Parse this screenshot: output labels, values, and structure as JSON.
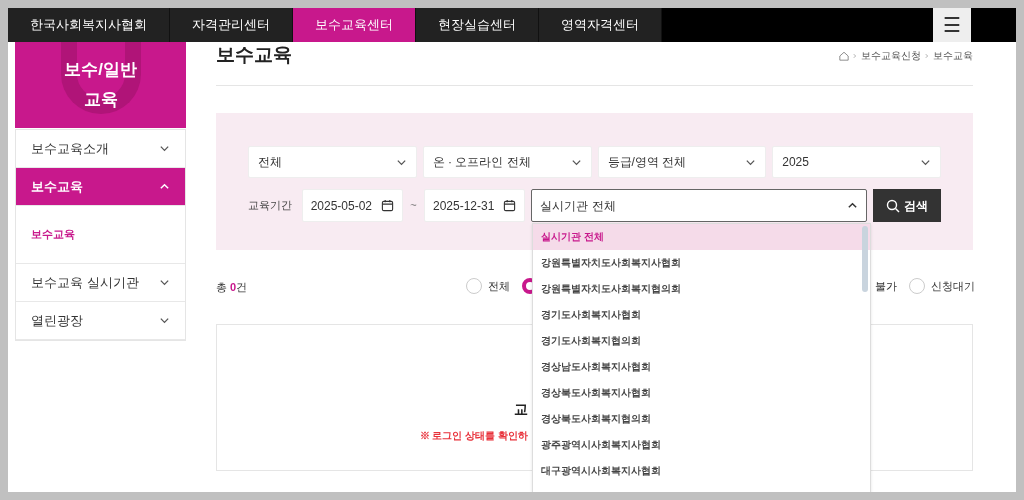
{
  "top_nav": {
    "tabs": [
      {
        "label": "한국사회복지사협회",
        "selected": false
      },
      {
        "label": "자격관리센터",
        "selected": false
      },
      {
        "label": "보수교육센터",
        "selected": true
      },
      {
        "label": "현장실습센터",
        "selected": false
      },
      {
        "label": "영역자격센터",
        "selected": false
      }
    ],
    "menu_button": "☰"
  },
  "sidebar": {
    "title": "보수/일반 교육",
    "items": [
      {
        "label": "보수교육소개",
        "expanded": false
      },
      {
        "label": "보수교육",
        "expanded": true,
        "children": [
          {
            "label": "보수교육",
            "selected": true
          }
        ]
      },
      {
        "label": "보수교육 실시기관",
        "expanded": false
      },
      {
        "label": "열린광장",
        "expanded": false
      }
    ]
  },
  "page_title": "보수교육",
  "breadcrumb": [
    "보수교육신청",
    "보수교육"
  ],
  "filters": {
    "selects": [
      {
        "value": "전체"
      },
      {
        "value": "온 · 오프라인 전체"
      },
      {
        "value": "등급/영역 전체"
      },
      {
        "value": "2025"
      }
    ],
    "period_label": "교육기간",
    "start_date": "2025-05-02",
    "separator": "~",
    "end_date": "2025-12-31",
    "institution": {
      "value": "실시기관 전체",
      "expanded": true
    },
    "search_button": "검색"
  },
  "institution_options": [
    {
      "label": "실시기관 전체",
      "selected": true
    },
    {
      "label": "강원특별자치도사회복지사협회",
      "selected": false
    },
    {
      "label": "강원특별자치도사회복지협의회",
      "selected": false
    },
    {
      "label": "경기도사회복지사협회",
      "selected": false
    },
    {
      "label": "경기도사회복지협의회",
      "selected": false
    },
    {
      "label": "경상남도사회복지사협회",
      "selected": false
    },
    {
      "label": "경상북도사회복지사협회",
      "selected": false
    },
    {
      "label": "경상북도사회복지협의회",
      "selected": false
    },
    {
      "label": "광주광역시사회복지사협회",
      "selected": false
    },
    {
      "label": "대구광역시사회복지사협회",
      "selected": false
    }
  ],
  "result": {
    "total_label": "총",
    "total": "0",
    "total_unit": "건"
  },
  "status_filters": [
    {
      "label": "전체",
      "selected": false
    },
    {
      "selected": true
    },
    {
      "label": "불가"
    },
    {
      "label": "신청대기",
      "selected": false
    }
  ],
  "empty_state": {
    "title": "교",
    "notice": "※ 로그인 상태를 확인하"
  }
}
